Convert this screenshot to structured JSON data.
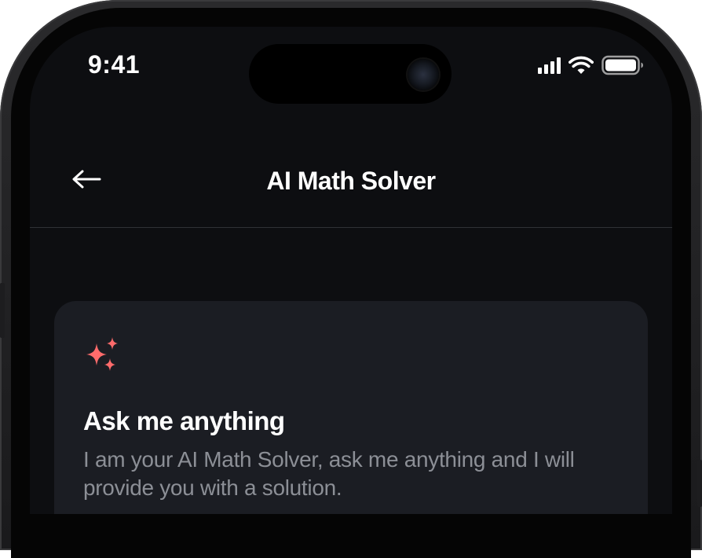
{
  "status_bar": {
    "time": "9:41",
    "icons": [
      "cellular-signal-icon",
      "wifi-icon",
      "battery-icon"
    ]
  },
  "header": {
    "back_icon": "arrow-left-icon",
    "title": "AI Math Solver"
  },
  "card": {
    "icon": "sparkle-icon",
    "title": "Ask me anything",
    "description": "I am your AI Math Solver, ask me anything and I will provide you with a solution."
  },
  "colors": {
    "screen_background": "#0d0e11",
    "card_background": "#1b1d23",
    "accent": "#ff6b6b",
    "text_primary": "#ffffff",
    "text_secondary": "#8c8f96"
  }
}
